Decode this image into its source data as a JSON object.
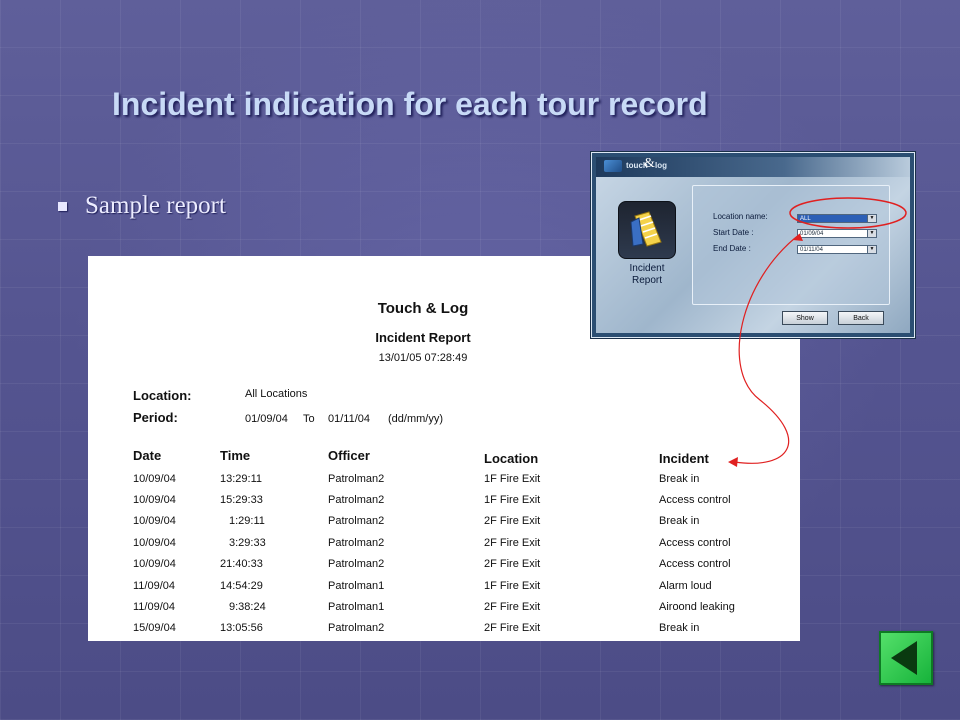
{
  "slide": {
    "title": "Incident indication for each tour record",
    "bullet": "Sample report"
  },
  "report": {
    "brand": "Touch &  Log",
    "name": "Incident Report",
    "generated": "13/01/05 07:28:49",
    "location_label": "Location:",
    "location_value": "All Locations",
    "period_label": "Period:",
    "period_from": "01/09/04",
    "period_to_label": "To",
    "period_to": "01/11/04",
    "period_format": "(dd/mm/yy)",
    "columns": [
      "Date",
      "Time",
      "Officer",
      "Location",
      "Incident"
    ],
    "rows": [
      [
        "10/09/04",
        "13:29:11",
        "Patrolman2",
        "1F Fire Exit",
        "Break in"
      ],
      [
        "10/09/04",
        "15:29:33",
        "Patrolman2",
        "1F Fire Exit",
        "Access control"
      ],
      [
        "10/09/04",
        "1:29:11",
        "Patrolman2",
        "2F Fire Exit",
        "Break in"
      ],
      [
        "10/09/04",
        "3:29:33",
        "Patrolman2",
        "2F Fire Exit",
        "Access control"
      ],
      [
        "10/09/04",
        "21:40:33",
        "Patrolman2",
        "2F Fire Exit",
        "Access control"
      ],
      [
        "11/09/04",
        "14:54:29",
        "Patrolman1",
        "1F Fire Exit",
        "Alarm loud"
      ],
      [
        "11/09/04",
        "9:38:24",
        "Patrolman1",
        "2F Fire Exit",
        "Airoond leaking"
      ],
      [
        "15/09/04",
        "13:05:56",
        "Patrolman2",
        "2F Fire Exit",
        "Break in"
      ]
    ]
  },
  "app": {
    "logo_text": "touch",
    "logo_amp": "&",
    "logo_text2": "log",
    "icon_label_line1": "Incident",
    "icon_label_line2": "Report",
    "location_label": "Location name:",
    "location_value": "ALL",
    "start_label": "Start Date :",
    "start_value": "01/09/04",
    "end_label": "End Date :",
    "end_value": "01/11/04",
    "show_button": "Show",
    "back_button": "Back"
  },
  "colors": {
    "title": "#c8daf6",
    "annotation": "#e02020",
    "nav_button": "#22c040"
  },
  "icons": {
    "nav_back": "left-triangle-icon",
    "app_logo": "touch-log-logo-icon",
    "app_report": "notepad-icon"
  }
}
